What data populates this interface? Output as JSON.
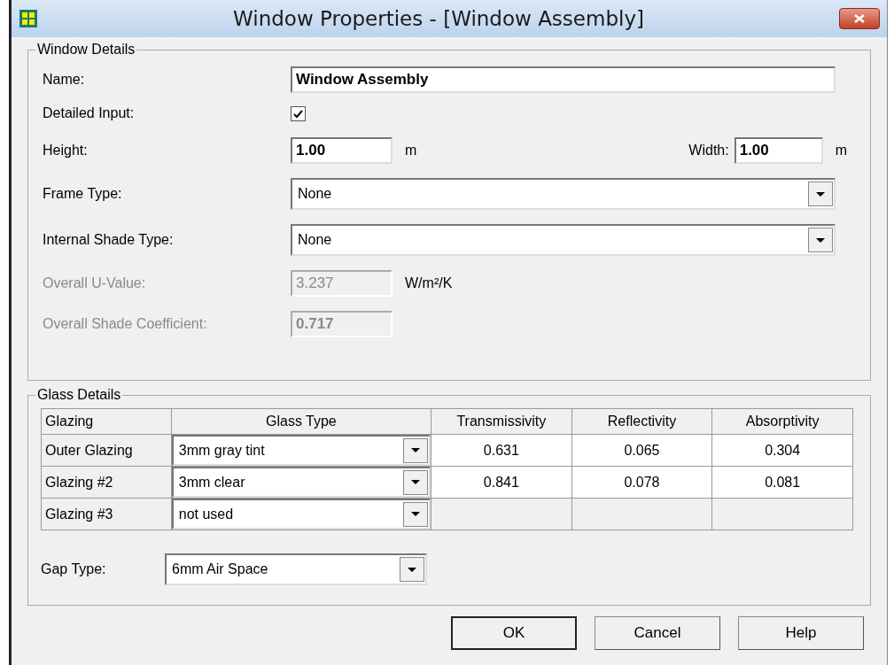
{
  "window": {
    "title": "Window Properties - [Window Assembly]"
  },
  "window_details": {
    "legend": "Window Details",
    "name": {
      "label": "Name:",
      "value": "Window Assembly"
    },
    "detailed_input": {
      "label": "Detailed Input:",
      "checked": true
    },
    "height": {
      "label": "Height:",
      "value": "1.00",
      "unit": "m"
    },
    "width": {
      "label": "Width:",
      "value": "1.00",
      "unit": "m"
    },
    "frame_type": {
      "label": "Frame Type:",
      "value": "None"
    },
    "internal_shade_type": {
      "label": "Internal Shade Type:",
      "value": "None"
    },
    "overall_u_value": {
      "label": "Overall U-Value:",
      "value": "3.237",
      "unit": "W/m²/K",
      "disabled": true
    },
    "overall_shade_coefficient": {
      "label": "Overall Shade Coefficient:",
      "value": "0.717",
      "disabled": true
    }
  },
  "glass_details": {
    "legend": "Glass Details",
    "columns": [
      "Glazing",
      "Glass Type",
      "Transmissivity",
      "Reflectivity",
      "Absorptivity"
    ],
    "rows": [
      {
        "glazing": "Outer Glazing",
        "glass_type": "3mm gray tint",
        "transmissivity": "0.631",
        "reflectivity": "0.065",
        "absorptivity": "0.304"
      },
      {
        "glazing": "Glazing #2",
        "glass_type": "3mm clear",
        "transmissivity": "0.841",
        "reflectivity": "0.078",
        "absorptivity": "0.081"
      },
      {
        "glazing": "Glazing #3",
        "glass_type": "not used"
      }
    ],
    "gap_type": {
      "label": "Gap Type:",
      "value": "6mm Air Space"
    }
  },
  "buttons": [
    {
      "label": "OK",
      "default": true
    },
    {
      "label": "Cancel",
      "default": false
    },
    {
      "label": "Help",
      "default": false
    }
  ]
}
